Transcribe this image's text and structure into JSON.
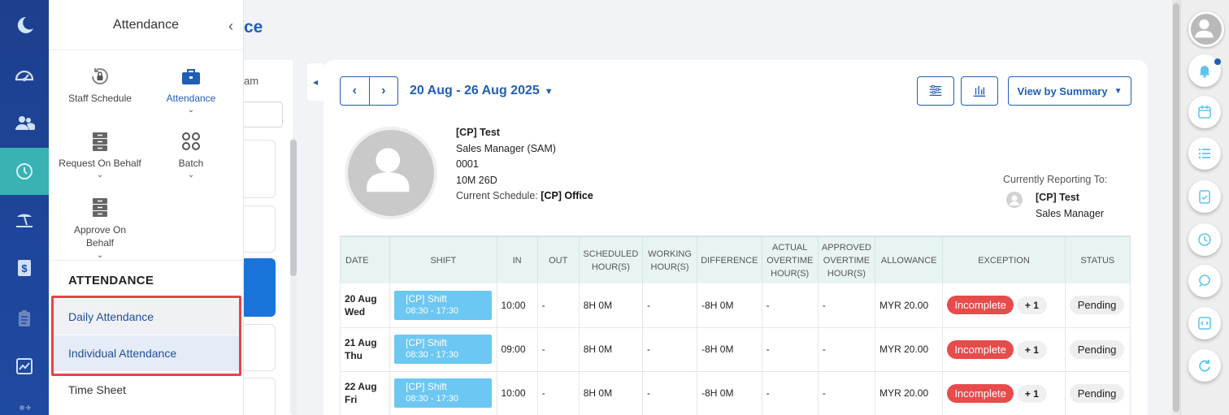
{
  "submenu": {
    "title": "Attendance",
    "tiles": {
      "staff_schedule": "Staff Schedule",
      "attendance": "Attendance",
      "request_on_behalf": "Request On Behalf",
      "batch": "Batch",
      "approve_on_behalf": "Approve On Behalf"
    },
    "section_title": "ATTENDANCE",
    "links": [
      "Daily Attendance",
      "Individual Attendance",
      "Time Sheet"
    ]
  },
  "background": {
    "page_title_fragment": "ce",
    "team_fragment": "am"
  },
  "toolbar": {
    "date_range": "20 Aug - 26 Aug 2025",
    "view_label": "View by Summary"
  },
  "employee": {
    "name": "[CP] Test",
    "position": "Sales Manager (SAM)",
    "id": "0001",
    "tenure": "10M 26D",
    "schedule_label": "Current Schedule:",
    "schedule_value": "[CP] Office"
  },
  "reporting": {
    "label": "Currently Reporting To:",
    "name": "[CP] Test",
    "title": "Sales Manager"
  },
  "table": {
    "headers": {
      "date": "DATE",
      "shift": "SHIFT",
      "in": "IN",
      "out": "OUT",
      "scheduled_1": "SCHEDULED",
      "scheduled_2": "HOUR(S)",
      "working_1": "WORKING",
      "working_2": "HOUR(S)",
      "difference": "DIFFERENCE",
      "actual_1": "ACTUAL",
      "actual_2": "OVERTIME",
      "actual_3": "HOUR(S)",
      "approved_1": "APPROVED",
      "approved_2": "OVERTIME",
      "approved_3": "HOUR(S)",
      "allowance": "ALLOWANCE",
      "exception": "EXCEPTION",
      "status": "STATUS"
    },
    "rows": [
      {
        "date": "20 Aug",
        "day": "Wed",
        "shift_name": "[CP] Shift",
        "shift_time": "08:30 - 17:30",
        "in": "10:00",
        "out": "-",
        "scheduled": "8H 0M",
        "working": "-",
        "difference": "-8H 0M",
        "actual_ot": "-",
        "approved_ot": "-",
        "allowance": "MYR 20.00",
        "exception": "Incomplete",
        "extra": "+ 1",
        "status": "Pending"
      },
      {
        "date": "21 Aug",
        "day": "Thu",
        "shift_name": "[CP] Shift",
        "shift_time": "08:30 - 17:30",
        "in": "09:00",
        "out": "-",
        "scheduled": "8H 0M",
        "working": "-",
        "difference": "-8H 0M",
        "actual_ot": "-",
        "approved_ot": "-",
        "allowance": "MYR 20.00",
        "exception": "Incomplete",
        "extra": "+ 1",
        "status": "Pending"
      },
      {
        "date": "22 Aug",
        "day": "Fri",
        "shift_name": "[CP] Shift",
        "shift_time": "08:30 - 17:30",
        "in": "10:00",
        "out": "-",
        "scheduled": "8H 0M",
        "working": "-",
        "difference": "-8H 0M",
        "actual_ot": "-",
        "approved_ot": "-",
        "allowance": "MYR 20.00",
        "exception": "Incomplete",
        "extra": "+ 1",
        "status": "Pending"
      }
    ]
  },
  "colors": {
    "rail": "#1f4aa1",
    "rail_active": "#38b2b3",
    "accent": "#1f5fb5",
    "shift": "#6cc7f2",
    "exception": "#e84b4b",
    "difference": "#e0332e",
    "highlight": "#e8424b"
  },
  "icons": {
    "rail": [
      "moon-logo-icon",
      "dashboard-gauge-icon",
      "people-icon",
      "clock-history-icon",
      "beach-leave-icon",
      "dollar-document-icon",
      "clipboard-icon",
      "chart-icon"
    ],
    "right": [
      "bell-icon",
      "calendar-icon",
      "list-icon",
      "clipboard-check-icon",
      "clock-icon",
      "chat-icon",
      "code-icon",
      "refresh-icon"
    ]
  }
}
